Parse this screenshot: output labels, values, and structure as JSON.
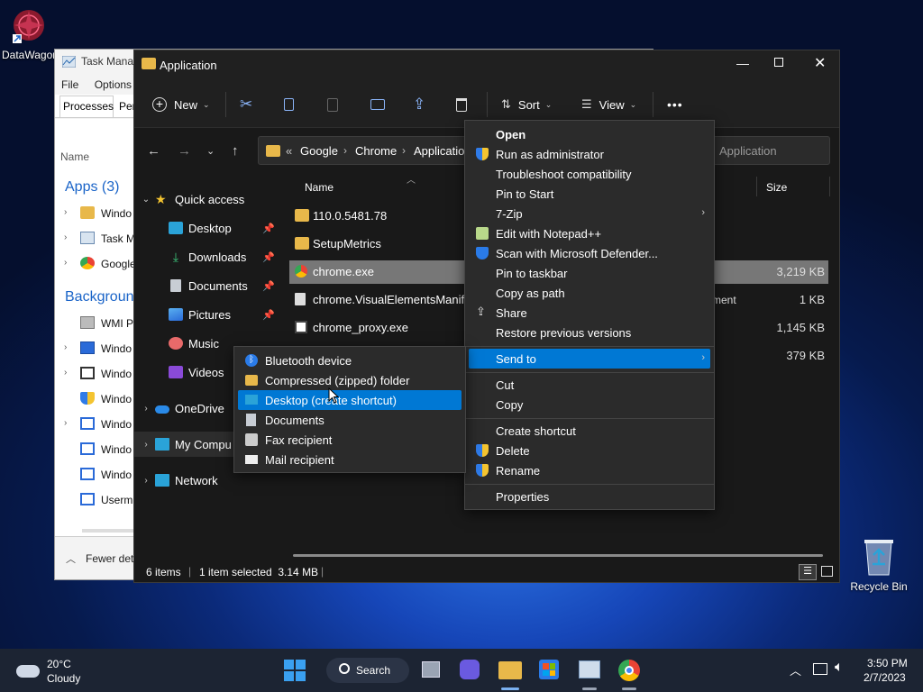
{
  "desktop": {
    "icon_datawagon": "DataWagon",
    "icon_recycle": "Recycle Bin"
  },
  "task_manager": {
    "title": "Task Manag",
    "menu": [
      "File",
      "Options"
    ],
    "tabs": [
      "Processes",
      "Per"
    ],
    "col_name": "Name",
    "apps_header": "Apps (3)",
    "background_header": "Backgroun",
    "apps": [
      "Windo",
      "Task M",
      "Google"
    ],
    "bg_items": [
      "WMI P",
      "Windo",
      "Windo",
      "Windo",
      "Windo",
      "Windo",
      "Windo",
      "Userm"
    ],
    "fewer": "Fewer deta"
  },
  "explorer": {
    "title": "Application",
    "toolbar": {
      "new_label": "New",
      "sort_label": "Sort",
      "view_label": "View",
      "more_label": "•••"
    },
    "address": {
      "overflow": "«",
      "crumbs": [
        "Google",
        "Chrome",
        "Application"
      ]
    },
    "search_placeholder": "Application",
    "nav": {
      "quick_access": "Quick access",
      "desktop": "Desktop",
      "downloads": "Downloads",
      "documents": "Documents",
      "pictures": "Pictures",
      "music": "Music",
      "videos": "Videos",
      "onedrive": "OneDrive",
      "my_computer": "My Compu",
      "network": "Network"
    },
    "columns": {
      "name": "Name",
      "type": "ment",
      "size": "Size"
    },
    "files": [
      {
        "name": "110.0.5481.78",
        "size": ""
      },
      {
        "name": "SetupMetrics",
        "size": ""
      },
      {
        "name": "chrome.exe",
        "size": "3,219 KB"
      },
      {
        "name": "chrome.VisualElementsManifest",
        "size": "1 KB"
      },
      {
        "name": "chrome_proxy.exe",
        "size": "1,145 KB"
      },
      {
        "name": "",
        "size": "379 KB"
      }
    ],
    "status": {
      "items": "6 items",
      "selected": "1 item selected  3.14 MB"
    }
  },
  "context_menu": {
    "items": [
      "Open",
      "Run as administrator",
      "Troubleshoot compatibility",
      "Pin to Start",
      "7-Zip",
      "Edit with Notepad++",
      "Scan with Microsoft Defender...",
      "Pin to taskbar",
      "Copy as path",
      "Share",
      "Restore previous versions",
      "Send to",
      "Cut",
      "Copy",
      "Create shortcut",
      "Delete",
      "Rename",
      "Properties"
    ]
  },
  "sendto_menu": {
    "items": [
      "Bluetooth device",
      "Compressed (zipped) folder",
      "Desktop (create shortcut)",
      "Documents",
      "Fax recipient",
      "Mail recipient"
    ]
  },
  "taskbar": {
    "weather_temp": "20°C",
    "weather_desc": "Cloudy",
    "search_label": "Search",
    "time": "3:50 PM",
    "date": "2/7/2023"
  },
  "colors": {
    "accent": "#0078d4",
    "folder": "#e8b84a"
  }
}
